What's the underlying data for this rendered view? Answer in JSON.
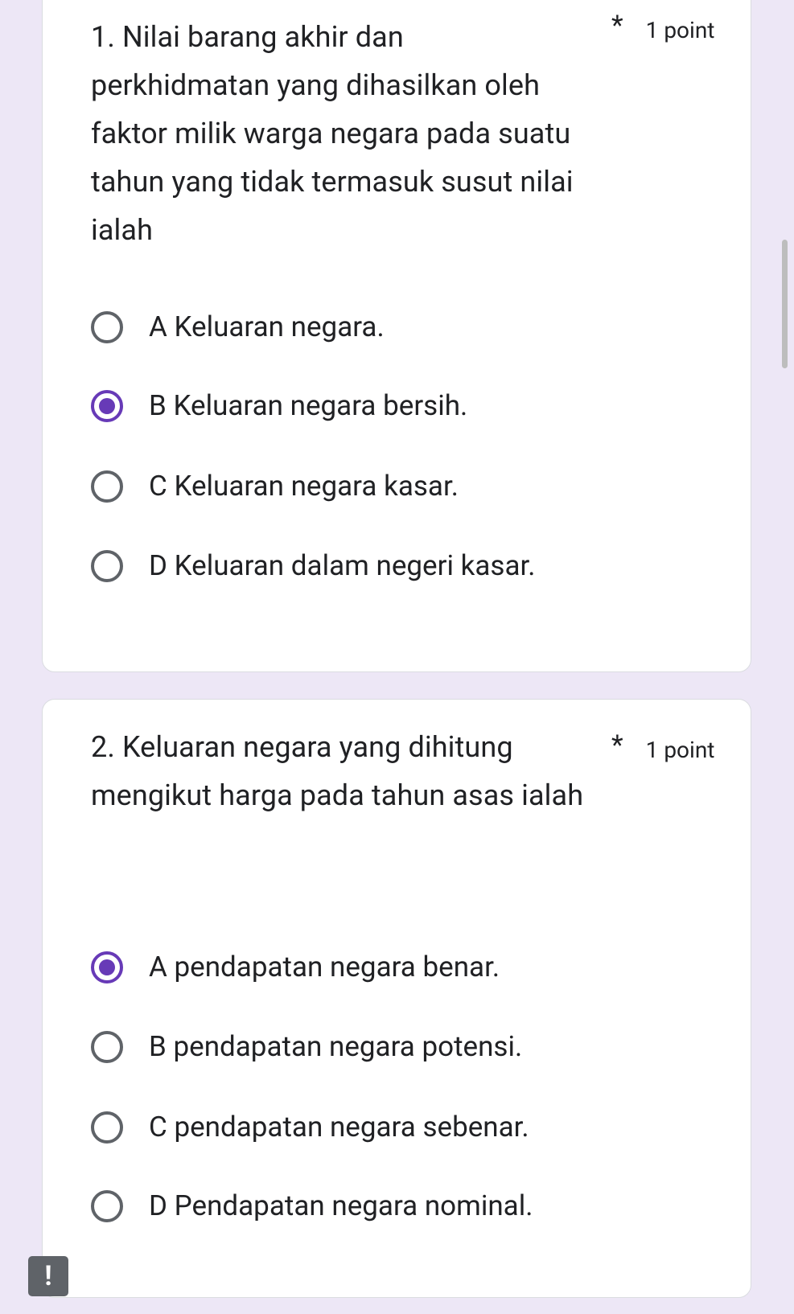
{
  "questions": [
    {
      "title": "1. Nilai barang akhir dan perkhidmatan yang dihasilkan oleh faktor milik warga negara pada suatu tahun yang tidak termasuk susut nilai ialah",
      "required_marker": "*",
      "points": "1 point",
      "options": [
        {
          "label": "A Keluaran negara.",
          "selected": false
        },
        {
          "label": "B Keluaran negara bersih.",
          "selected": true
        },
        {
          "label": "C Keluaran negara kasar.",
          "selected": false
        },
        {
          "label": "D Keluaran dalam negeri kasar.",
          "selected": false
        }
      ]
    },
    {
      "title": "2. Keluaran negara yang dihitung mengikut harga pada tahun asas ialah",
      "required_marker": "*",
      "points": "1 point",
      "options": [
        {
          "label": "A pendapatan negara benar.",
          "selected": true
        },
        {
          "label": "B pendapatan negara potensi.",
          "selected": false
        },
        {
          "label": "C pendapatan negara sebenar.",
          "selected": false
        },
        {
          "label": "D Pendapatan negara nominal.",
          "selected": false
        }
      ]
    }
  ],
  "alert_badge": "!",
  "colors": {
    "background": "#ede7f6",
    "accent": "#673ab7",
    "radio_unselected": "#5f6368"
  }
}
